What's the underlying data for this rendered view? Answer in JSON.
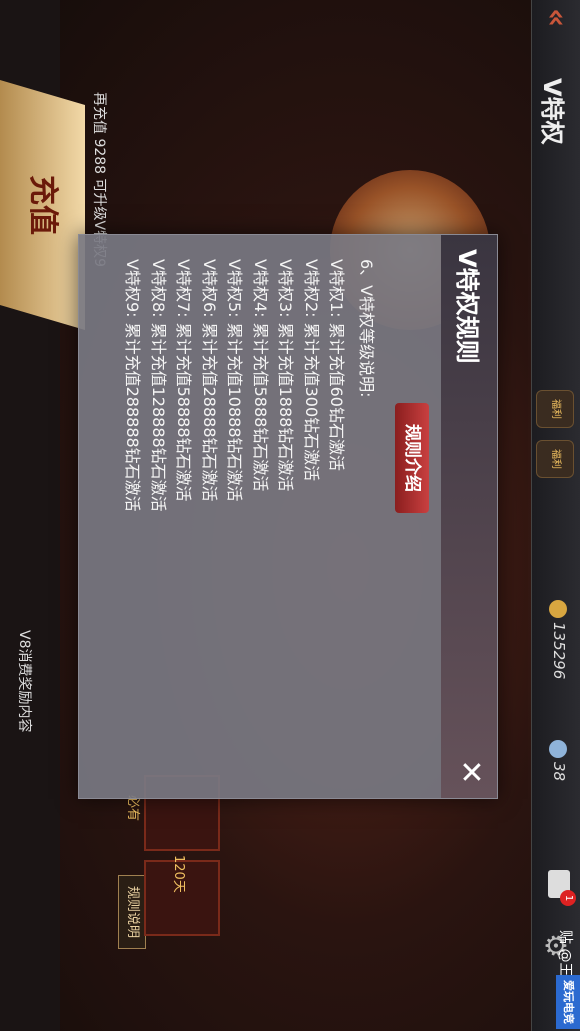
{
  "header": {
    "back_icon": "double-chevron-left-icon",
    "title": "V特权",
    "gift_labels": [
      "福利",
      "福利"
    ],
    "gems": "38",
    "coins": "135296",
    "mail_badge": "1"
  },
  "main": {
    "recharge_label": "充值",
    "recharge_hint": "再充值 9288 可升级V特权9",
    "v_content_label": "V8消费奖励内容",
    "rules_button_label": "规则说明",
    "reward_tags": [
      "必有",
      "120天"
    ]
  },
  "modal": {
    "title": "V特权规则",
    "tab_label": "规则介绍",
    "heading": "6、V特权等级说明:",
    "lines": [
      "V特权1: 累计充值60钻石激活",
      "V特权2: 累计充值300钻石激活",
      "V特权3: 累计充值1888钻石激活",
      "V特权4: 累计充值5888钻石激活",
      "V特权5: 累计充值10888钻石激活",
      "V特权6: 累计充值28888钻石激活",
      "V特权7: 累计充值58888钻石激活",
      "V特权8: 累计充值128888钻石激活",
      "V特权9: 累计充值288888钻石激活"
    ],
    "close_icon": "close-icon"
  },
  "watermark": {
    "text": "贴 @王",
    "logo": "爱玩电竞"
  }
}
